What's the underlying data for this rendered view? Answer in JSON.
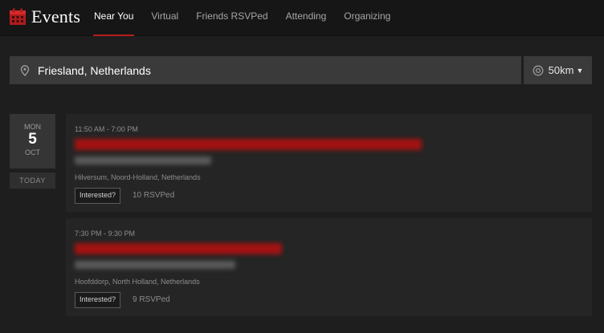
{
  "header": {
    "title": "Events",
    "tabs": [
      {
        "label": "Near You",
        "active": true
      },
      {
        "label": "Virtual",
        "active": false
      },
      {
        "label": "Friends RSVPed",
        "active": false
      },
      {
        "label": "Attending",
        "active": false
      },
      {
        "label": "Organizing",
        "active": false
      }
    ],
    "icon": "calendar-icon"
  },
  "search": {
    "location": "Friesland, Netherlands",
    "radius": "50km",
    "icon": "map-pin-icon",
    "radius_icon": "target-icon"
  },
  "date": {
    "dow": "MON",
    "day": "5",
    "month": "OCT",
    "today_label": "TODAY"
  },
  "events": [
    {
      "time": "11:50 AM - 7:00 PM",
      "location": "Hilversum, Noord-Holland, Netherlands",
      "interested_label": "Interested?",
      "rsvp": "10 RSVPed"
    },
    {
      "time": "7:30 PM - 9:30 PM",
      "location": "Hoofddorp, North Holland, Netherlands",
      "interested_label": "Interested?",
      "rsvp": "9 RSVPed"
    }
  ],
  "colors": {
    "accent": "#b51d1d",
    "background": "#1e1e1e",
    "card": "#252525"
  }
}
